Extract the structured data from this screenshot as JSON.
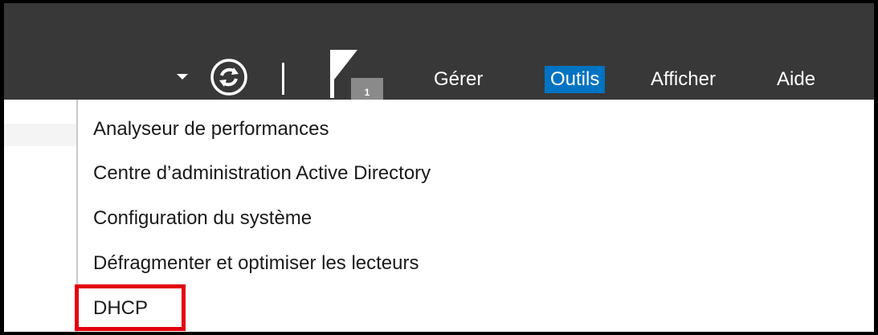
{
  "toolbar": {
    "dropdown_icon": "chevron-down-icon",
    "refresh_icon": "refresh-icon",
    "flag_icon": "notifications-flag-icon",
    "notification_count": "1"
  },
  "menu": {
    "items": [
      {
        "label": "Gérer"
      },
      {
        "label": "Outils",
        "active": true
      },
      {
        "label": "Afficher"
      },
      {
        "label": "Aide"
      }
    ]
  },
  "tools_menu": {
    "items": [
      {
        "label": "Analyseur de performances"
      },
      {
        "label": "Centre d’administration Active Directory"
      },
      {
        "label": "Configuration du système"
      },
      {
        "label": "Défragmenter et optimiser les lecteurs"
      },
      {
        "label": "DHCP",
        "highlighted": true
      }
    ]
  },
  "colors": {
    "titlebar_bg": "#383838",
    "active_menu_bg": "#0073c2",
    "highlight_border": "#e3000f"
  }
}
